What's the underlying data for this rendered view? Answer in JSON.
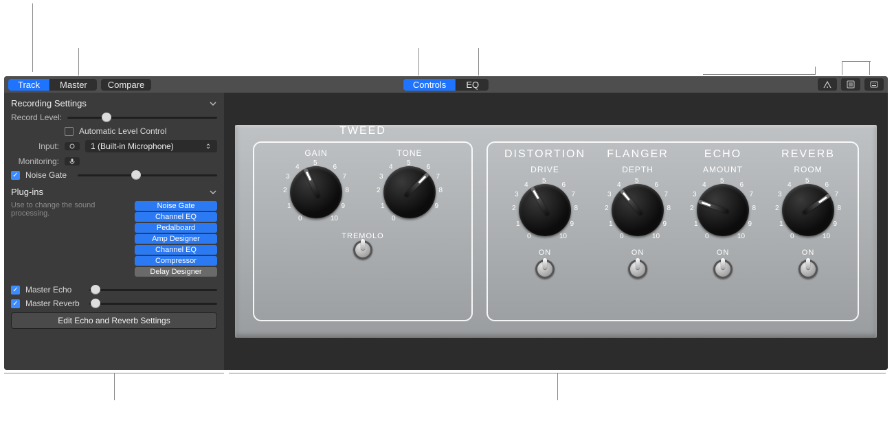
{
  "toolbar": {
    "track": "Track",
    "master": "Master",
    "compare": "Compare",
    "controls": "Controls",
    "eq": "EQ"
  },
  "sidebar": {
    "recording": {
      "header": "Recording Settings",
      "record_level_label": "Record Level:",
      "auto_level_label": "Automatic Level Control",
      "input_label": "Input:",
      "input_value": "1  (Built-in Microphone)",
      "monitoring_label": "Monitoring:"
    },
    "noise_gate": {
      "label": "Noise Gate"
    },
    "plugins": {
      "header": "Plug-ins",
      "note": "Use to change the sound processing.",
      "items": [
        "Noise Gate",
        "Channel EQ",
        "Pedalboard",
        "Amp Designer",
        "Channel EQ",
        "Compressor",
        "Delay Designer"
      ]
    },
    "master_echo": {
      "label": "Master Echo"
    },
    "master_reverb": {
      "label": "Master Reverb"
    },
    "edit_button": "Edit Echo and Reverb Settings"
  },
  "amp": {
    "dial": [
      "0",
      "1",
      "2",
      "3",
      "4",
      "5",
      "6",
      "7",
      "8",
      "9",
      "10"
    ],
    "on_label": "ON",
    "panels": [
      {
        "title": "TWEED",
        "knobs": [
          "GAIN",
          "TONE"
        ],
        "toggle": "TREMOLO"
      },
      {
        "effects": [
          {
            "title": "DISTORTION",
            "knob": "DRIVE"
          },
          {
            "title": "FLANGER",
            "knob": "DEPTH"
          },
          {
            "title": "ECHO",
            "knob": "AMOUNT"
          },
          {
            "title": "REVERB",
            "knob": "ROOM"
          }
        ]
      }
    ]
  }
}
